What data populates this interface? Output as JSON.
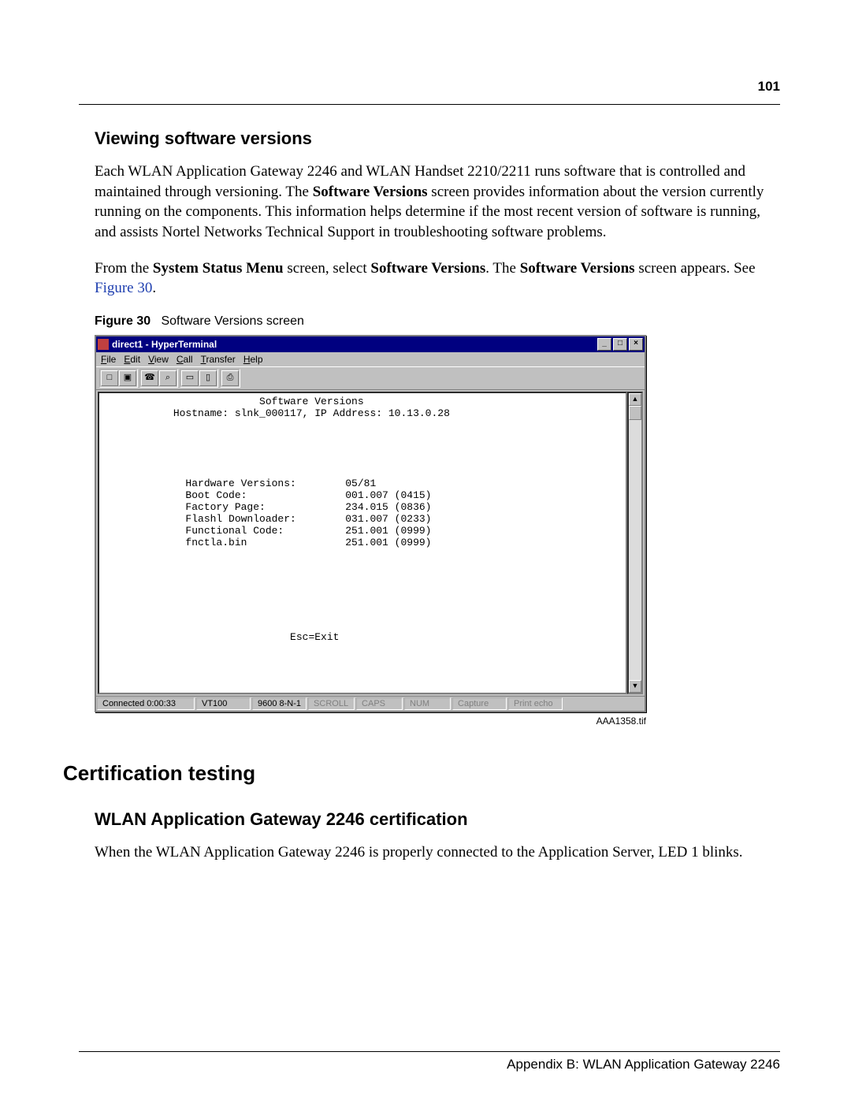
{
  "page_number": "101",
  "section1": {
    "heading": "Viewing software versions",
    "para1_pre": "Each WLAN Application Gateway 2246 and WLAN Handset 2210/2211 runs software that is controlled and maintained through versioning. The ",
    "para1_bold1": "Software Versions",
    "para1_post": " screen provides information about the version currently running on the components. This information helps determine if the most recent version of software is running, and assists Nortel Networks Technical Support in troubleshooting software problems.",
    "para2_pre": "From the ",
    "para2_bold1": "System Status Menu",
    "para2_mid1": " screen, select ",
    "para2_bold2": "Software Versions",
    "para2_mid2": ". The ",
    "para2_bold3": "Software Versions",
    "para2_mid3": " screen appears. See ",
    "para2_link": "Figure 30",
    "para2_end": "."
  },
  "figure": {
    "label": "Figure 30",
    "caption": "Software Versions screen",
    "image_id": "AAA1358.tif"
  },
  "hyperterminal": {
    "title": "direct1 - HyperTerminal",
    "menus": {
      "file": "File",
      "edit": "Edit",
      "view": "View",
      "call": "Call",
      "transfer": "Transfer",
      "help": "Help"
    },
    "window_buttons": {
      "min": "_",
      "max": "□",
      "close": "×"
    },
    "toolbar_icons": [
      "□",
      "▣",
      "☎",
      "⌕",
      "▭",
      "▯",
      "⎙"
    ],
    "scroll": {
      "up": "▲",
      "down": "▼"
    },
    "terminal_text": "                         Software Versions\n           Hostname: slnk_000117, IP Address: 10.13.0.28\n\n\n\n\n\n             Hardware Versions:        05/81\n             Boot Code:                001.007 (0415)\n             Factory Page:             234.015 (0836)\n             Flashl Downloader:        031.007 (0233)\n             Functional Code:          251.001 (0999)\n             fnctla.bin                251.001 (0999)\n\n\n\n\n\n\n\n                              Esc=Exit",
    "chart_data": {
      "type": "table",
      "title": "Software Versions",
      "hostname": "slnk_000117",
      "ip_address": "10.13.0.28",
      "rows": [
        {
          "label": "Hardware Versions:",
          "value": "05/81"
        },
        {
          "label": "Boot Code:",
          "value": "001.007 (0415)"
        },
        {
          "label": "Factory Page:",
          "value": "234.015 (0836)"
        },
        {
          "label": "Flashl Downloader:",
          "value": "031.007 (0233)"
        },
        {
          "label": "Functional Code:",
          "value": "251.001 (0999)"
        },
        {
          "label": "fnctla.bin",
          "value": "251.001 (0999)"
        }
      ],
      "footer": "Esc=Exit"
    },
    "status": {
      "connected": "Connected 0:00:33",
      "emulation": "VT100",
      "settings": "9600 8-N-1",
      "scroll": "SCROLL",
      "caps": "CAPS",
      "num": "NUM",
      "capture": "Capture",
      "printecho": "Print echo"
    }
  },
  "section2": {
    "heading": "Certification testing",
    "sub_heading": "WLAN Application Gateway 2246 certification",
    "para": "When the WLAN Application Gateway 2246 is properly connected to the Application Server, LED 1 blinks."
  },
  "footer": "Appendix B: WLAN Application Gateway 2246"
}
